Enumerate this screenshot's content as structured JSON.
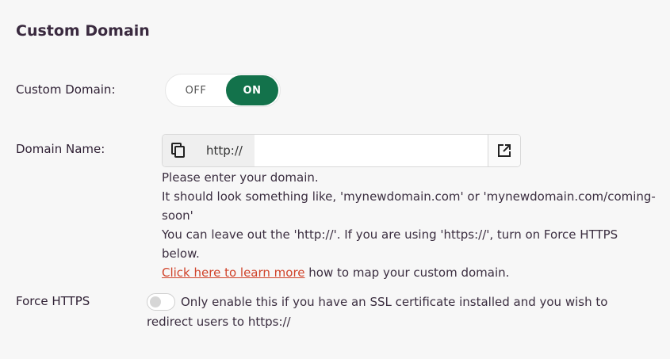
{
  "section": {
    "title": "Custom Domain"
  },
  "custom_domain": {
    "label": "Custom Domain:",
    "off_label": "OFF",
    "on_label": "ON",
    "state": "on"
  },
  "domain_name": {
    "label": "Domain Name:",
    "prefix": "http://",
    "value": "",
    "help_line1": "Please enter your domain.",
    "help_line2": "It should look something like, 'mynewdomain.com' or 'mynewdomain.com/coming-soon'",
    "help_line3": "You can leave out the 'http://'. If you are using 'https://', turn on Force HTTPS below.",
    "learn_link": "Click here to learn more",
    "learn_suffix": " how to map your custom domain."
  },
  "force_https": {
    "label": "Force HTTPS",
    "enabled": false,
    "note": "Only enable this if you have an SSL certificate installed and you wish to redirect users to https://"
  },
  "icons": {
    "copy": "copy-icon",
    "open": "external-link-icon"
  },
  "colors": {
    "accent": "#13724b",
    "link": "#d0432a"
  }
}
